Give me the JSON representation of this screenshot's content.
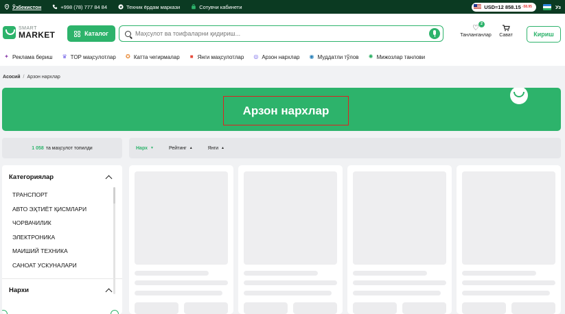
{
  "topbar": {
    "location": "Ўзбекистон",
    "phone": "+998 (78) 777 84 84",
    "support": "Техник ёрдам маркази",
    "seller": "Сотувчи кабинети",
    "usd_rate": "USD=12 858.15",
    "usd_delta": "-58.95",
    "language": "Уз"
  },
  "header": {
    "logo_top": "SMART",
    "logo_bottom": "MARKET",
    "catalog_label": "Каталог",
    "search_placeholder": "Маҳсулот ва тоифаларни қидириш...",
    "favorites_label": "Танланганлар",
    "favorites_count": "2",
    "cart_label": "Сават",
    "login_label": "Кириш"
  },
  "menu": [
    {
      "label": "Реклама бериш",
      "icon": "megaphone-icon",
      "color": "#8e44ad"
    },
    {
      "label": "TOP маҳсулотлар",
      "icon": "trophy-icon",
      "color": "#6c5ce7"
    },
    {
      "label": "Катта чегирмалар",
      "icon": "discount-icon",
      "color": "#e67e22"
    },
    {
      "label": "Янги маҳсулотлар",
      "icon": "new-icon",
      "color": "#e74c3c"
    },
    {
      "label": "Арзон нархлар",
      "icon": "price-tag-icon",
      "color": "#6c5ce7"
    },
    {
      "label": "Муддатли тўлов",
      "icon": "installment-icon",
      "color": "#2980b9"
    },
    {
      "label": "Мижозлар танлови",
      "icon": "customers-choice-icon",
      "color": "#27ae60"
    }
  ],
  "breadcrumb": {
    "home": "Асосий",
    "separator": "/",
    "current": "Арзон нархлар"
  },
  "banner": {
    "title": "Арзон нархлар"
  },
  "results": {
    "count": "1 058",
    "suffix": "та маҳсулот топилди"
  },
  "sort": [
    {
      "label": "Нарх",
      "arrow": "▼",
      "active": true
    },
    {
      "label": "Рейтинг",
      "arrow": "▲",
      "active": false
    },
    {
      "label": "Янги",
      "arrow": "▲",
      "active": false
    }
  ],
  "sidebar": {
    "categories_title": "Категориялар",
    "categories": [
      "ТРАНСПОРТ",
      "АВТО ЭҲТИЁТ ҚИСМЛАРИ",
      "ЧОРВАЧИЛИК",
      "ЭЛЕКТРОНИКА",
      "МАИШИЙ ТЕХНИКА",
      "САНОАТ УСКУНАЛАРИ"
    ],
    "price_title": "Нархи"
  },
  "colors": {
    "brand": "#2db36b",
    "topbar": "#0b3a22",
    "highlight_border": "#e02020"
  }
}
